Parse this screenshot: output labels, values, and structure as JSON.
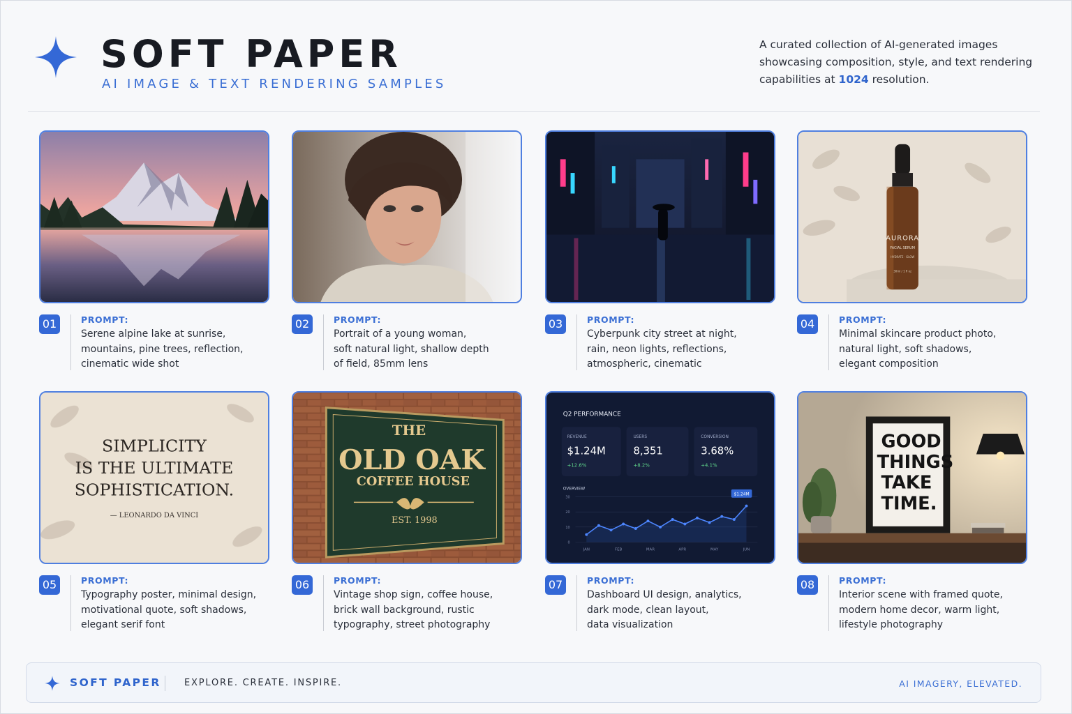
{
  "header": {
    "title": "SOFT PAPER",
    "subtitle": "AI IMAGE & TEXT RENDERING SAMPLES",
    "intro_part1": "A curated collection of AI-generated images showcasing composition, style, and text rendering capabilities at ",
    "intro_highlight": "1024",
    "intro_part2": " resolution.",
    "logo_icon": "four-point-star-icon"
  },
  "colors": {
    "accent": "#3468d6",
    "background": "#f7f8fa",
    "text": "#1e2330"
  },
  "prompt_label": "PROMPT:",
  "cards": [
    {
      "number": "01",
      "lines": [
        "Serene alpine lake at sunrise,",
        "mountains, pine trees, reflection,",
        "cinematic wide shot"
      ]
    },
    {
      "number": "02",
      "lines": [
        "Portrait of a young woman,",
        "soft natural light, shallow depth",
        "of field, 85mm lens"
      ]
    },
    {
      "number": "03",
      "lines": [
        "Cyberpunk city street at night,",
        "rain, neon lights, reflections,",
        "atmospheric, cinematic"
      ]
    },
    {
      "number": "04",
      "lines": [
        "Minimal skincare product photo,",
        "natural light, soft shadows,",
        "elegant composition"
      ]
    },
    {
      "number": "05",
      "lines": [
        "Typography poster, minimal design,",
        "motivational quote, soft shadows,",
        "elegant serif font"
      ]
    },
    {
      "number": "06",
      "lines": [
        "Vintage shop sign, coffee house,",
        "brick wall background, rustic",
        "typography, street photography"
      ]
    },
    {
      "number": "07",
      "lines": [
        "Dashboard UI design, analytics,",
        "dark mode, clean layout,",
        "data visualization"
      ]
    },
    {
      "number": "08",
      "lines": [
        "Interior scene with framed quote,",
        "modern home decor, warm light,",
        "lifestyle photography"
      ]
    }
  ],
  "images": {
    "product": {
      "brand": "AURORA",
      "sub": "FACIAL SERUM",
      "detail": "HYDRATE · GLOW",
      "volume": "30ml / 1 fl oz"
    },
    "poster": {
      "line1": "SIMPLICITY",
      "line2": "IS THE ULTIMATE",
      "line3": "SOPHISTICATION.",
      "author": "— LEONARDO DA VINCI"
    },
    "sign": {
      "line1": "THE",
      "line2": "OLD OAK",
      "line3": "COFFEE HOUSE",
      "line4": "EST. 1998"
    },
    "frame_quote": {
      "line1": "GOOD",
      "line2": "THINGS",
      "line3": "TAKE",
      "line4": "TIME."
    },
    "dashboard": {
      "title": "Q2 PERFORMANCE",
      "stats": [
        {
          "label": "REVENUE",
          "value": "$1.24M",
          "delta": "+12.6%"
        },
        {
          "label": "USERS",
          "value": "8,351",
          "delta": "+8.2%"
        },
        {
          "label": "CONVERSION",
          "value": "3.68%",
          "delta": "+4.1%"
        }
      ],
      "overview_label": "OVERVIEW",
      "tooltip": "$1.24M"
    }
  },
  "chart_data": {
    "type": "line",
    "x": [
      "JAN",
      "FEB",
      "MAR",
      "APR",
      "MAY",
      "JUN"
    ],
    "y_ticks": [
      0,
      10,
      20,
      30
    ],
    "series": [
      {
        "values": [
          5,
          11,
          8,
          12,
          9,
          14,
          10,
          15,
          12,
          16,
          13,
          17,
          15,
          24
        ]
      }
    ],
    "ylim": [
      0,
      30
    ]
  },
  "footer": {
    "brand": "SOFT PAPER",
    "tagline": "EXPLORE. CREATE. INSPIRE.",
    "right": "AI IMAGERY, ELEVATED."
  }
}
